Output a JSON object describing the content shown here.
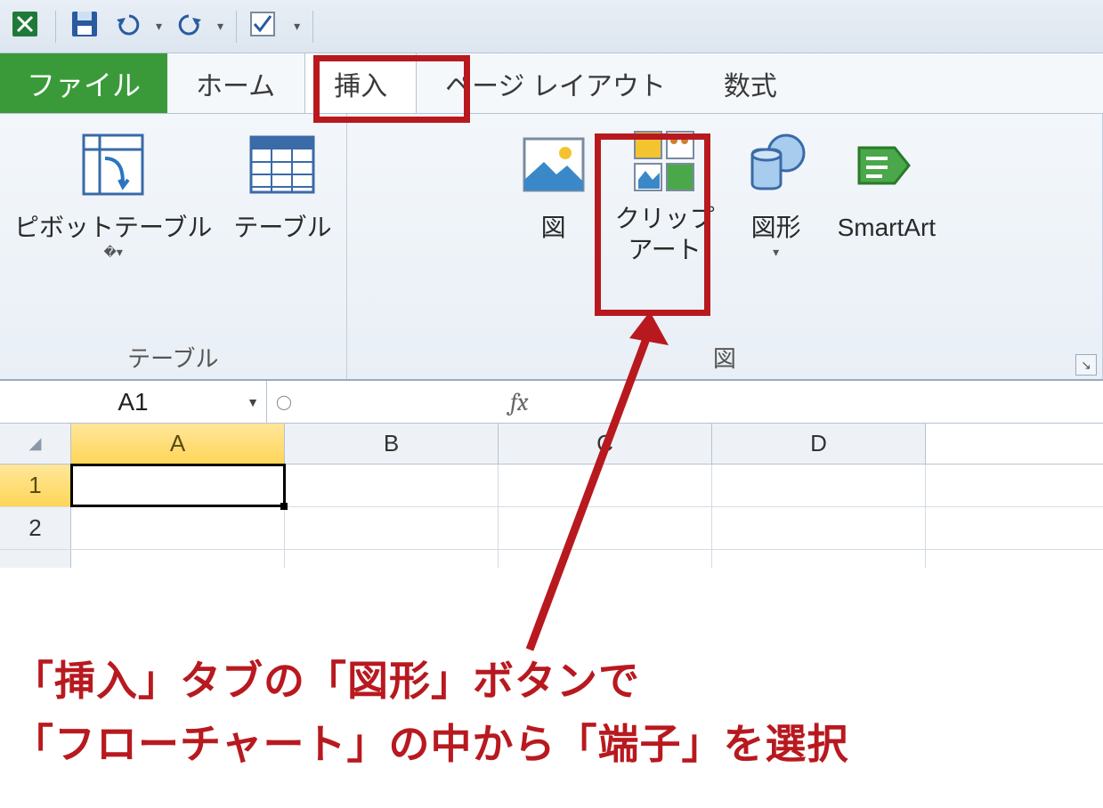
{
  "qat": {
    "undo_dd": "▾",
    "redo_dd": "▾"
  },
  "tabs": {
    "file": "ファイル",
    "home": "ホーム",
    "insert": "挿入",
    "page_layout": "ページ レイアウト",
    "formulas": "数式"
  },
  "ribbon": {
    "tables_group": {
      "pivot": "ピボットテーブル",
      "table": "テーブル",
      "label": "テーブル"
    },
    "illust_group": {
      "picture": "図",
      "clipart_line1": "クリップ",
      "clipart_line2": "アート",
      "shapes": "図形",
      "smartart": "SmartArt",
      "label": "図"
    }
  },
  "formula_bar": {
    "cell_ref": "A1",
    "fx": "fx"
  },
  "grid": {
    "cols": [
      "A",
      "B",
      "C",
      "D"
    ],
    "rows": [
      "1",
      "2"
    ],
    "active_col": 0,
    "active_row": 0
  },
  "annotation": {
    "line1": "「挿入」タブの「図形」ボタンで",
    "line2": "「フローチャート」の中から「端子」を選択"
  }
}
